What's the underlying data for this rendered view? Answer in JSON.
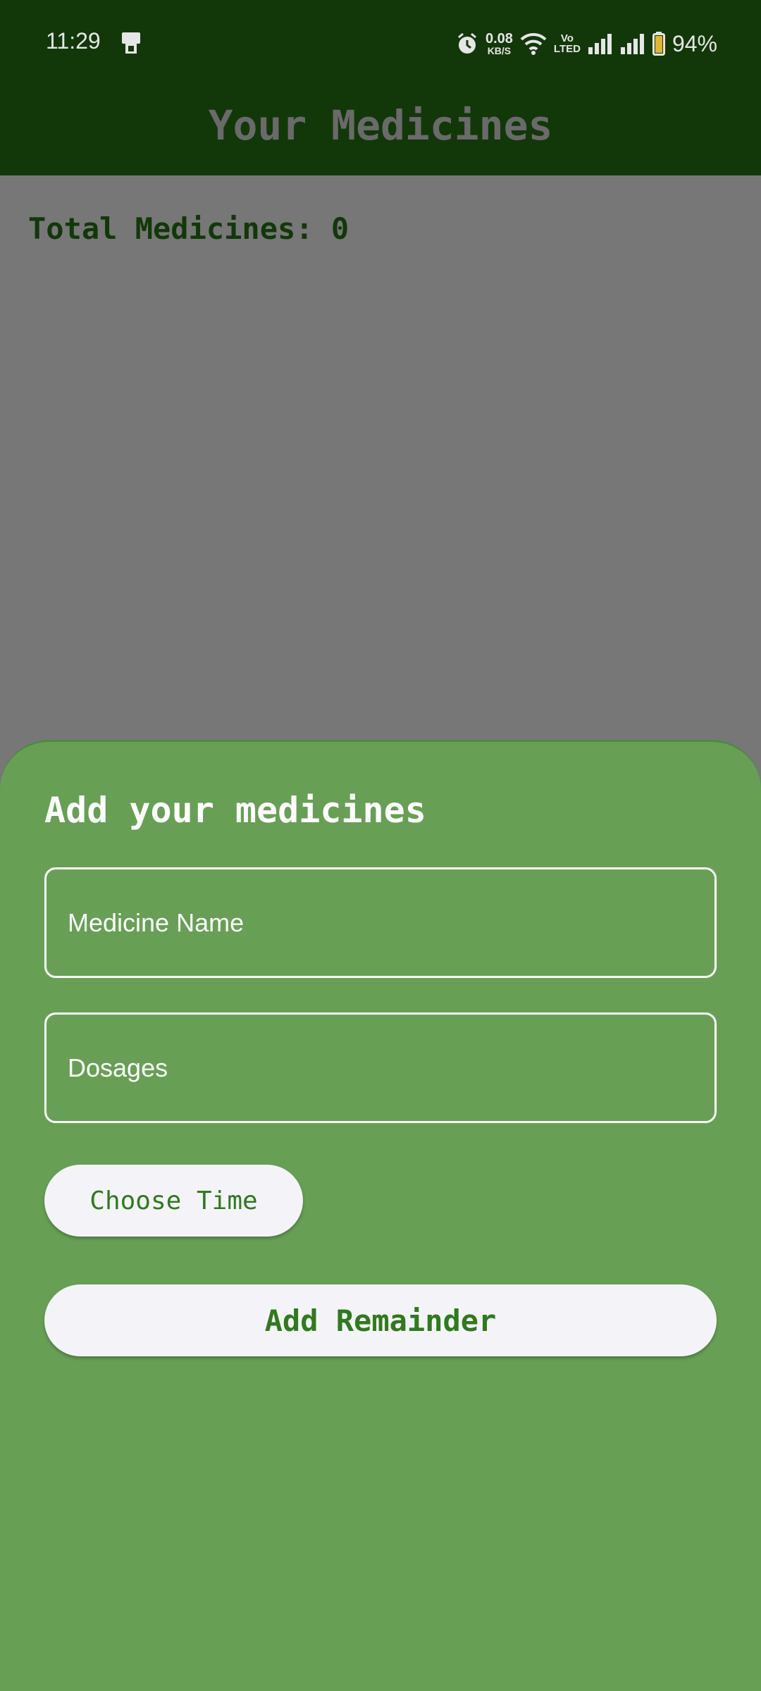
{
  "status_bar": {
    "time": "11:29",
    "net_speed_value": "0.08",
    "net_speed_unit": "KB/S",
    "volte_top": "Vo",
    "volte_bottom": "LTED",
    "battery": "94%",
    "icons": [
      "cast-icon",
      "alarm-icon",
      "wifi-icon",
      "signal-icon",
      "battery-icon"
    ]
  },
  "appbar": {
    "title": "Your Medicines"
  },
  "main": {
    "total_label": "Total Medicines: 0"
  },
  "sheet": {
    "title": "Add your medicines",
    "medicine_name_placeholder": "Medicine Name",
    "dosages_placeholder": "Dosages",
    "choose_time_label": "Choose Time",
    "add_button_label": "Add Remainder"
  },
  "colors": {
    "appbar": "#12380a",
    "scrim": "#777777",
    "sheet": "#67a055",
    "button_bg": "#f4f4f8",
    "button_text": "#2f7a1d"
  }
}
